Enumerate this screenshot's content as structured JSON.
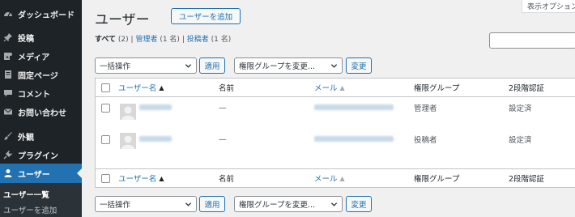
{
  "sidebar": {
    "items": [
      {
        "name": "dashboard",
        "label": "ダッシュボード",
        "icon": "dashboard-icon"
      },
      {
        "name": "posts",
        "label": "投稿",
        "icon": "pin-icon"
      },
      {
        "name": "media",
        "label": "メディア",
        "icon": "media-icon"
      },
      {
        "name": "pages",
        "label": "固定ページ",
        "icon": "page-icon"
      },
      {
        "name": "comments",
        "label": "コメント",
        "icon": "comment-icon"
      },
      {
        "name": "contact",
        "label": "お問い合わせ",
        "icon": "mail-icon"
      },
      {
        "name": "appearance",
        "label": "外観",
        "icon": "brush-icon"
      },
      {
        "name": "plugins",
        "label": "プラグイン",
        "icon": "plugin-icon"
      },
      {
        "name": "users",
        "label": "ユーザー",
        "icon": "user-icon"
      }
    ],
    "submenu": {
      "current": "ユーザー一覧",
      "add_new": "ユーザーを追加"
    }
  },
  "header": {
    "title": "ユーザー",
    "add_button": "ユーザーを追加",
    "screen_options": "表示オプション"
  },
  "filters": {
    "all": "すべて",
    "all_count": "(2)",
    "sep1": "|",
    "admin": "管理者",
    "admin_count": "(1 名)",
    "sep2": "|",
    "author": "投稿者",
    "author_count": "(1 名)"
  },
  "bulk": {
    "action_select": "一括操作",
    "apply": "適用",
    "role_select": "権限グループを変更...",
    "change": "変更"
  },
  "table": {
    "columns": {
      "username": "ユーザー名",
      "name": "名前",
      "email": "メール",
      "role": "権限グループ",
      "twofa": "2段階認証"
    },
    "rows": [
      {
        "name": "—",
        "role": "管理者",
        "twofa": "設定済"
      },
      {
        "name": "—",
        "role": "投稿者",
        "twofa": "設定済"
      }
    ]
  },
  "colors": {
    "sidebar_bg": "#1d2327",
    "accent": "#2271b1",
    "page_bg": "#f0f0f1"
  }
}
